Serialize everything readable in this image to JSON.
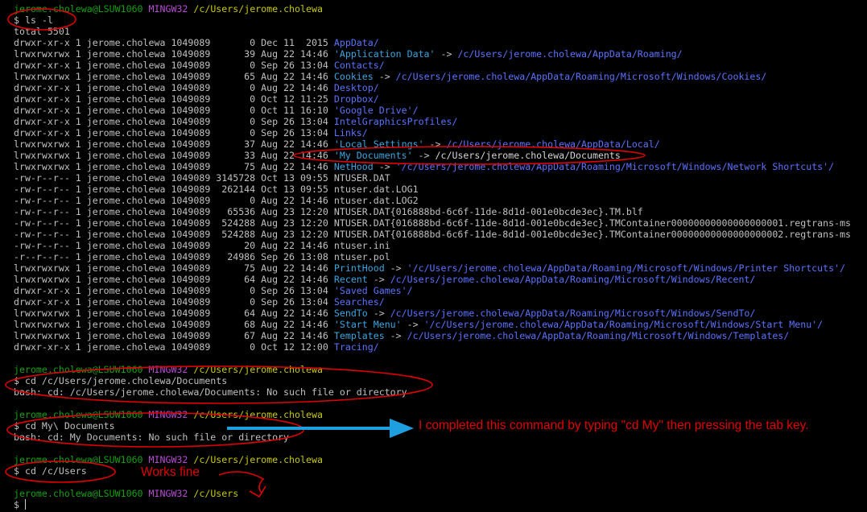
{
  "prompts": [
    {
      "user": "jerome.cholewa@LSUW1060",
      "sys": "MINGW32",
      "path": "/c/Users/jerome.cholewa",
      "command": "$ ls -l",
      "output": [
        "total 5501"
      ]
    },
    {
      "user": "jerome.cholewa@LSUW1060",
      "sys": "MINGW32",
      "path": "/c/Users/jerome.cholewa",
      "command": "$ cd /c/Users/jerome.cholewa/Documents",
      "output": [
        "bash: cd: /c/Users/jerome.cholewa/Documents: No such file or directory"
      ]
    },
    {
      "user": "jerome.cholewa@LSUW1060",
      "sys": "MINGW32",
      "path": "/c/Users/jerome.cholewa",
      "command": "$ cd My\\ Documents",
      "output": [
        "bash: cd: My Documents: No such file or directory"
      ]
    },
    {
      "user": "jerome.cholewa@LSUW1060",
      "sys": "MINGW32",
      "path": "/c/Users/jerome.cholewa",
      "command": "$ cd /c/Users",
      "output": []
    },
    {
      "user": "jerome.cholewa@LSUW1060",
      "sys": "MINGW32",
      "path": "/c/Users",
      "command": "$ ",
      "output": []
    }
  ],
  "listing": [
    {
      "meta": "drwxr-xr-x 1 jerome.cholewa 1049089       0 Dec 11  2015 ",
      "name": "AppData/",
      "cls": "blu"
    },
    {
      "meta": "lrwxrwxrwx 1 jerome.cholewa 1049089      39 Aug 22 14:46 ",
      "name": "'Application Data'",
      "cls": "cyn",
      "arrow": " -> ",
      "target": "/c/Users/jerome.cholewa/AppData/Roaming/",
      "tcls": "blu"
    },
    {
      "meta": "drwxr-xr-x 1 jerome.cholewa 1049089       0 Sep 26 13:04 ",
      "name": "Contacts/",
      "cls": "blu"
    },
    {
      "meta": "lrwxrwxrwx 1 jerome.cholewa 1049089      65 Aug 22 14:46 ",
      "name": "Cookies",
      "cls": "cyn",
      "arrow": " -> ",
      "target": "/c/Users/jerome.cholewa/AppData/Roaming/Microsoft/Windows/Cookies/",
      "tcls": "blu"
    },
    {
      "meta": "drwxr-xr-x 1 jerome.cholewa 1049089       0 Aug 22 14:46 ",
      "name": "Desktop/",
      "cls": "blu"
    },
    {
      "meta": "drwxr-xr-x 1 jerome.cholewa 1049089       0 Oct 12 11:25 ",
      "name": "Dropbox/",
      "cls": "blu"
    },
    {
      "meta": "drwxr-xr-x 1 jerome.cholewa 1049089       0 Oct 11 16:10 ",
      "name": "'Google Drive'/",
      "cls": "blu"
    },
    {
      "meta": "drwxr-xr-x 1 jerome.cholewa 1049089       0 Sep 26 13:04 ",
      "name": "IntelGraphicsProfiles/",
      "cls": "blu"
    },
    {
      "meta": "drwxr-xr-x 1 jerome.cholewa 1049089       0 Sep 26 13:04 ",
      "name": "Links/",
      "cls": "blu"
    },
    {
      "meta": "lrwxrwxrwx 1 jerome.cholewa 1049089      37 Aug 22 14:46 ",
      "name": "'Local Settings'",
      "cls": "cyn",
      "arrow": " -> ",
      "target": "/c/Users/jerome.cholewa/AppData/Local/",
      "tcls": "blu"
    },
    {
      "meta": "lrwxrwxrwx 1 jerome.cholewa 1049089      33 Aug 22 14:46 ",
      "name": "'My Documents'",
      "cls": "cyn",
      "arrow": " -> ",
      "target": "/c/Users/jerome.cholewa/Documents",
      "tcls": "wht"
    },
    {
      "meta": "lrwxrwxrwx 1 jerome.cholewa 1049089      75 Aug 22 14:46 ",
      "name": "NetHood",
      "cls": "cyn",
      "arrow": " -> ",
      "target": "'/c/Users/jerome.cholewa/AppData/Roaming/Microsoft/Windows/Network Shortcuts'/",
      "tcls": "blu"
    },
    {
      "meta": "-rw-r--r-- 1 jerome.cholewa 1049089 3145728 Oct 13 09:55 ",
      "name": "NTUSER.DAT",
      "cls": ""
    },
    {
      "meta": "-rw-r--r-- 1 jerome.cholewa 1049089  262144 Oct 13 09:55 ",
      "name": "ntuser.dat.LOG1",
      "cls": ""
    },
    {
      "meta": "-rw-r--r-- 1 jerome.cholewa 1049089       0 Aug 22 14:46 ",
      "name": "ntuser.dat.LOG2",
      "cls": ""
    },
    {
      "meta": "-rw-r--r-- 1 jerome.cholewa 1049089   65536 Aug 23 12:20 ",
      "name": "NTUSER.DAT{016888bd-6c6f-11de-8d1d-001e0bcde3ec}.TM.blf",
      "cls": ""
    },
    {
      "meta": "-rw-r--r-- 1 jerome.cholewa 1049089  524288 Aug 23 12:20 ",
      "name": "NTUSER.DAT{016888bd-6c6f-11de-8d1d-001e0bcde3ec}.TMContainer00000000000000000001.regtrans-ms",
      "cls": ""
    },
    {
      "meta": "-rw-r--r-- 1 jerome.cholewa 1049089  524288 Aug 23 12:20 ",
      "name": "NTUSER.DAT{016888bd-6c6f-11de-8d1d-001e0bcde3ec}.TMContainer00000000000000000002.regtrans-ms",
      "cls": ""
    },
    {
      "meta": "-rw-r--r-- 1 jerome.cholewa 1049089      20 Aug 22 14:46 ",
      "name": "ntuser.ini",
      "cls": ""
    },
    {
      "meta": "-r--r--r-- 1 jerome.cholewa 1049089   24986 Sep 26 13:08 ",
      "name": "ntuser.pol",
      "cls": ""
    },
    {
      "meta": "lrwxrwxrwx 1 jerome.cholewa 1049089      75 Aug 22 14:46 ",
      "name": "PrintHood",
      "cls": "cyn",
      "arrow": " -> ",
      "target": "'/c/Users/jerome.cholewa/AppData/Roaming/Microsoft/Windows/Printer Shortcuts'/",
      "tcls": "blu"
    },
    {
      "meta": "lrwxrwxrwx 1 jerome.cholewa 1049089      64 Aug 22 14:46 ",
      "name": "Recent",
      "cls": "cyn",
      "arrow": " -> ",
      "target": "/c/Users/jerome.cholewa/AppData/Roaming/Microsoft/Windows/Recent/",
      "tcls": "blu"
    },
    {
      "meta": "drwxr-xr-x 1 jerome.cholewa 1049089       0 Sep 26 13:04 ",
      "name": "'Saved Games'/",
      "cls": "blu"
    },
    {
      "meta": "drwxr-xr-x 1 jerome.cholewa 1049089       0 Sep 26 13:04 ",
      "name": "Searches/",
      "cls": "blu"
    },
    {
      "meta": "lrwxrwxrwx 1 jerome.cholewa 1049089      64 Aug 22 14:46 ",
      "name": "SendTo",
      "cls": "cyn",
      "arrow": " -> ",
      "target": "/c/Users/jerome.cholewa/AppData/Roaming/Microsoft/Windows/SendTo/",
      "tcls": "blu"
    },
    {
      "meta": "lrwxrwxrwx 1 jerome.cholewa 1049089      68 Aug 22 14:46 ",
      "name": "'Start Menu'",
      "cls": "cyn",
      "arrow": " -> ",
      "target": "'/c/Users/jerome.cholewa/AppData/Roaming/Microsoft/Windows/Start Menu'/",
      "tcls": "blu"
    },
    {
      "meta": "lrwxrwxrwx 1 jerome.cholewa 1049089      67 Aug 22 14:46 ",
      "name": "Templates",
      "cls": "cyn",
      "arrow": " -> ",
      "target": "/c/Users/jerome.cholewa/AppData/Roaming/Microsoft/Windows/Templates/",
      "tcls": "blu"
    },
    {
      "meta": "drwxr-xr-x 1 jerome.cholewa 1049089       0 Oct 12 12:00 ",
      "name": "Tracing/",
      "cls": "blu"
    }
  ],
  "annotations": {
    "tab_note": "I completed this command by typing \"cd My\" then pressing the tab key.",
    "works_fine": "Works fine"
  },
  "colors": {
    "background": "#000000",
    "prompt_user": "#13a10e",
    "prompt_sys": "#b94bd6",
    "prompt_path": "#c8c800",
    "dir": "#5a73ff",
    "link": "#3aa6e0",
    "annotation": "#e00000",
    "arrow": "#1ea0e0"
  }
}
